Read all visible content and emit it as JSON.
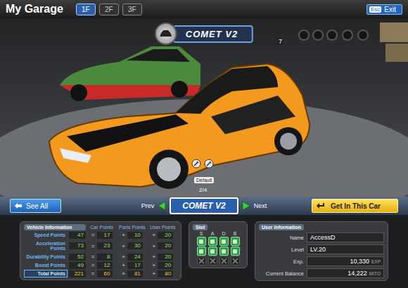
{
  "header": {
    "title": "My Garage",
    "floors": [
      {
        "label": "1F",
        "selected": true
      },
      {
        "label": "2F",
        "selected": false
      },
      {
        "label": "3F",
        "selected": false
      }
    ],
    "exit": {
      "key": "Esc",
      "label": "Exit"
    }
  },
  "showroom": {
    "car_name": "COMET V2",
    "tire_count": "7",
    "paint": "Default",
    "page": "2/4"
  },
  "nav": {
    "see_all": "See All",
    "prev": "Prev",
    "current": "COMET V2",
    "next": "Next",
    "get_in": "Get In This Car"
  },
  "vehicle_info": {
    "title": "Vehicle Information",
    "columns": [
      "Car Points",
      "Parts Points",
      "User Points"
    ],
    "signs": {
      "equals": "=",
      "plus": "+"
    },
    "rows": [
      {
        "label": "Speed Points",
        "total": "47",
        "car": "17",
        "parts": "10",
        "user": "20",
        "selected": false
      },
      {
        "label": "Acceleration Points",
        "total": "73",
        "car": "23",
        "parts": "30",
        "user": "20",
        "selected": false
      },
      {
        "label": "Durability Points",
        "total": "52",
        "car": "8",
        "parts": "24",
        "user": "20",
        "selected": false
      },
      {
        "label": "Boost Points",
        "total": "49",
        "car": "12",
        "parts": "17",
        "user": "20",
        "selected": false
      },
      {
        "label": "Total Points",
        "total": "221",
        "car": "60",
        "parts": "81",
        "user": "80",
        "selected": true
      }
    ]
  },
  "slot": {
    "title": "Slot",
    "columns": [
      "S",
      "A",
      "D",
      "B"
    ],
    "rows": [
      [
        {
          "locked": false
        },
        {
          "locked": false
        },
        {
          "locked": false
        },
        {
          "locked": false
        }
      ],
      [
        {
          "locked": false
        },
        {
          "locked": false
        },
        {
          "locked": false
        },
        {
          "locked": false
        }
      ],
      [
        {
          "locked": true
        },
        {
          "locked": true
        },
        {
          "locked": true
        },
        {
          "locked": true
        }
      ]
    ]
  },
  "user_info": {
    "title": "User Information",
    "fields": [
      {
        "label": "Name",
        "value": "AccessD",
        "unit": ""
      },
      {
        "label": "Level",
        "value": "LV.20",
        "unit": ""
      },
      {
        "label": "Exp.",
        "value": "10,330",
        "unit": "EXP"
      },
      {
        "label": "Current Balance",
        "value": "14,222",
        "unit": "MITO"
      }
    ]
  }
}
